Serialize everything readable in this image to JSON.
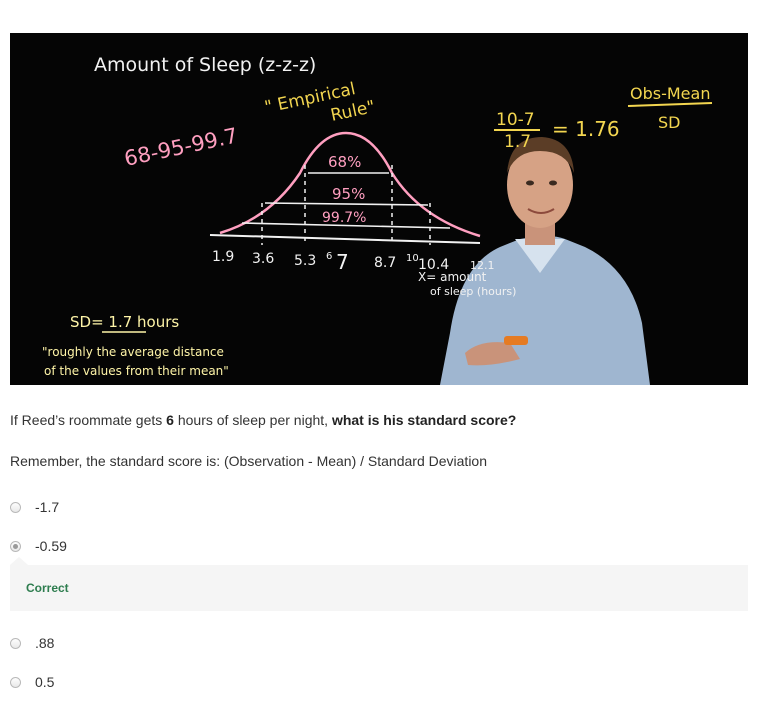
{
  "video": {
    "board": {
      "title": "Amount of Sleep (z-z-z)",
      "rule_line1": "\" Empirical",
      "rule_line2": "Rule\"",
      "percentages": "68-95-99.7",
      "formula_num": "10-7",
      "formula_den": "1.7",
      "formula_result": "= 1.76",
      "obs_mean": "Obs-Mean",
      "sd_label": "SD",
      "pct68": "68%",
      "pct95": "95%",
      "pct997": "99.7%",
      "ticks": [
        "1.9",
        "3.6",
        "5.3",
        "6",
        "7",
        "8.7",
        "10",
        "10.4",
        "12.1"
      ],
      "x_label_1": "X= amount",
      "x_label_2": "of sleep (hours)",
      "sd_value": "SD= 1.7 hours",
      "quote_1": "\"roughly the average distance",
      "quote_2": "of the values from their mean\""
    }
  },
  "question": {
    "prefix": "If Reed’s roommate gets ",
    "hours": "6",
    "middle": " hours of sleep per night, ",
    "bold_tail": "what is his standard score?"
  },
  "reminder": "Remember, the standard score is: (Observation - Mean) / Standard Deviation",
  "options": [
    {
      "label": "-1.7",
      "selected": false
    },
    {
      "label": "-0.59",
      "selected": true
    },
    {
      "label": ".88",
      "selected": false
    },
    {
      "label": "0.5",
      "selected": false
    }
  ],
  "feedback": {
    "text": "Correct",
    "color": "#2e7d4f"
  }
}
